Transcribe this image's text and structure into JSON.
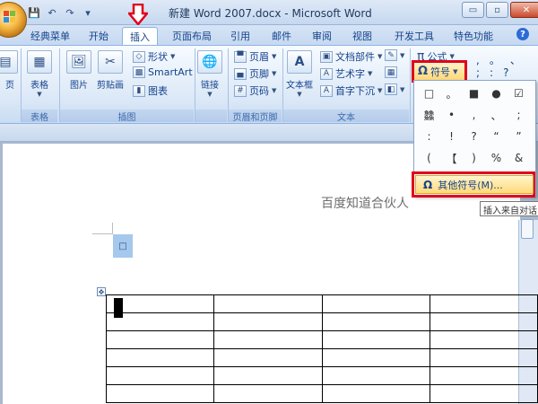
{
  "window": {
    "title": "新建 Word 2007.docx - Microsoft Word",
    "controls": {
      "minimize": "▭",
      "restore": "▫",
      "close": "✕"
    }
  },
  "qat": {
    "save": "💾",
    "undo": "↶",
    "redo": "↷",
    "more": "▾"
  },
  "tabs": [
    {
      "label": "经典菜单"
    },
    {
      "label": "开始"
    },
    {
      "label": "插入"
    },
    {
      "label": "页面布局"
    },
    {
      "label": "引用"
    },
    {
      "label": "邮件"
    },
    {
      "label": "审阅"
    },
    {
      "label": "视图"
    },
    {
      "label": "开发工具"
    },
    {
      "label": "特色功能"
    }
  ],
  "help_label": "?",
  "ribbon": {
    "pages": {
      "label": "页"
    },
    "table_group": {
      "button": "表格",
      "group_label": "表格"
    },
    "illustrations": {
      "picture": "图片",
      "clipart": "剪贴画",
      "shapes": "形状",
      "smartart": "SmartArt",
      "chart": "图表",
      "group_label": "插图"
    },
    "links": {
      "button": "链接"
    },
    "header_footer": {
      "header": "页眉",
      "footer": "页脚",
      "page_number": "页码",
      "group_label": "页眉和页脚"
    },
    "text": {
      "textbox": "文本框",
      "quickparts": "文档部件",
      "wordart": "艺术字",
      "dropcap": "首字下沉",
      "group_label": "文本"
    },
    "symbols": {
      "equation": "公式",
      "symbol": "符号",
      "equation_glyph": "π",
      "symbol_glyph": "Ω"
    },
    "special_chars": [
      ",",
      "。",
      "、",
      ";",
      ":",
      "?"
    ]
  },
  "symbol_dropdown": {
    "rows": [
      [
        "□",
        "。",
        "■",
        "●",
        "☑"
      ],
      [
        "䲜",
        "•",
        ",",
        "、",
        ";"
      ],
      [
        ":",
        "!",
        "?",
        "“",
        "”"
      ],
      [
        "(",
        "【",
        ")",
        "%",
        "&"
      ]
    ],
    "more_symbols": "其他符号(M)...",
    "more_glyph": "Ω"
  },
  "tooltip": "插入来自对话",
  "document": {
    "watermark": "百度知道合伙人",
    "selection_glyph": "□",
    "table_rows": 6,
    "table_cols": 4
  },
  "colors": {
    "accent": "#e0001b",
    "ribbon_bg": "#dbe8f7",
    "highlight": "#ffd97a"
  }
}
